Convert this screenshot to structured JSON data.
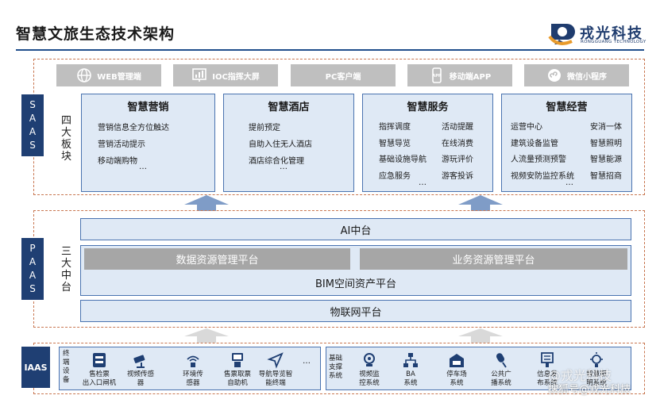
{
  "title": "智慧文旅生态技术架构",
  "logo": {
    "name_cn": "戎光科技",
    "name_en": "RONGGUANG TECHNOLOGY"
  },
  "saas": {
    "tag": [
      "S",
      "A",
      "A",
      "S"
    ],
    "label": [
      "四",
      "大",
      "板",
      "块"
    ],
    "clients": [
      {
        "icon": "globe-icon",
        "label": "WEB管理端"
      },
      {
        "icon": "chart-screen-icon",
        "label": "IOC指挥大屏"
      },
      {
        "icon": "",
        "label": "PC客户端"
      },
      {
        "icon": "app-icon",
        "label": "移动端APP"
      },
      {
        "icon": "mini-program-icon",
        "label": "微信小程序"
      }
    ],
    "modules": [
      {
        "title": "智慧营销",
        "lines": [
          "营销信息全方位触达",
          "营销活动提示",
          "移动端购物"
        ],
        "more": "…"
      },
      {
        "title": "智慧酒店",
        "lines": [
          "提前预定",
          "自助入住无人酒店",
          "酒店综合化管理"
        ],
        "more": "…"
      },
      {
        "title": "智慧服务",
        "left": [
          "指挥调度",
          "智慧导览",
          "基础设施导航",
          "应急服务"
        ],
        "right": [
          "活动提醒",
          "在线消费",
          "游玩评价",
          "游客投诉"
        ],
        "more": "…"
      },
      {
        "title": "智慧经营",
        "left": [
          "运营中心",
          "建筑设备监管",
          "人流量预测预警",
          "视频安防监控系统"
        ],
        "right": [
          "安消一体",
          "智慧照明",
          "智慧能源",
          "智慧招商"
        ],
        "more": "…"
      }
    ]
  },
  "paas": {
    "tag": [
      "P",
      "A",
      "A",
      "S"
    ],
    "label": [
      "三",
      "大",
      "中",
      "台"
    ],
    "ai": "AI中台",
    "data_platform": "数据资源管理平台",
    "business_platform": "业务资源管理平台",
    "bim": "BIM空间资产平台",
    "iot": "物联网平台"
  },
  "iaas": {
    "tag": "IAAS",
    "terminal_label": [
      "终",
      "端",
      "设",
      "备"
    ],
    "terminal_devices": [
      {
        "icon": "ticket-gate-icon",
        "label": [
          "售检票",
          "出入口闸机"
        ]
      },
      {
        "icon": "camera-icon",
        "label": [
          "视频传感",
          "器"
        ]
      },
      {
        "icon": "env-sensor-icon",
        "label": [
          "环境传",
          "感器"
        ]
      },
      {
        "icon": "kiosk-icon",
        "label": [
          "售票取票",
          "自助机"
        ]
      },
      {
        "icon": "navigation-icon",
        "label": [
          "导航导览智",
          "能终端"
        ]
      }
    ],
    "terminal_more": "…",
    "infra_label": [
      "基础",
      "支撑",
      "系统"
    ],
    "infra_systems": [
      {
        "icon": "video-monitor-icon",
        "label": [
          "视频监",
          "控系统"
        ]
      },
      {
        "icon": "ba-system-icon",
        "label": [
          "BA",
          "系统"
        ]
      },
      {
        "icon": "parking-icon",
        "label": [
          "停车场",
          "系统"
        ]
      },
      {
        "icon": "broadcast-icon",
        "label": [
          "公共广",
          "播系统"
        ]
      },
      {
        "icon": "info-release-icon",
        "label": [
          "信息发",
          "布系统"
        ]
      },
      {
        "icon": "lighting-icon",
        "label": [
          "智慧照",
          "明系统"
        ]
      }
    ]
  },
  "watermark": {
    "line1": "@戎光科技",
    "line2": "搜狐号@戎光科技"
  },
  "colors": {
    "navy": "#1f3f73",
    "panel": "#dfe9f5",
    "border": "#4a73b0",
    "dashed": "#c87650",
    "gray": "#a6a6a6"
  }
}
